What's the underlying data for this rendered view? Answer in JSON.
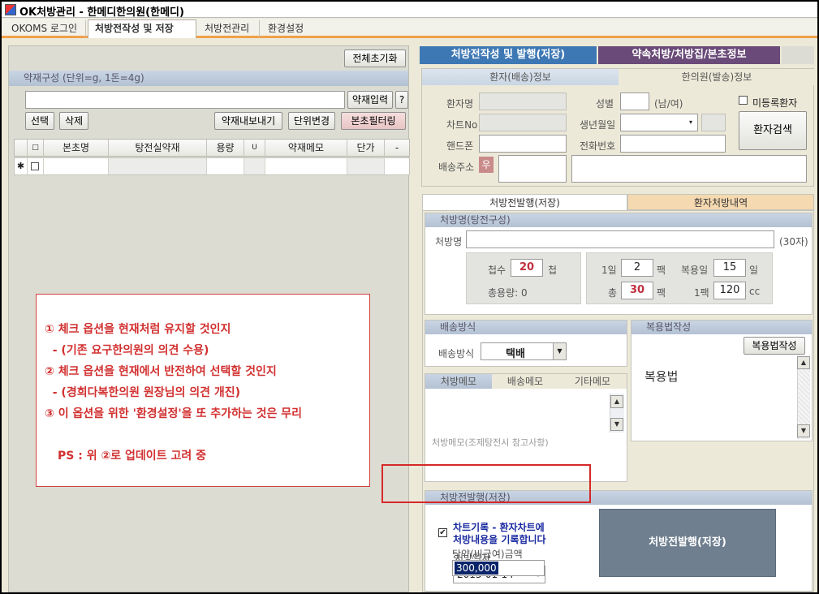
{
  "window": {
    "title": "OK처방관리 - 한메디한의원(한메디)"
  },
  "tabs": [
    {
      "label": "OKOMS 로그인"
    },
    {
      "label": "처방전작성 및 저장"
    },
    {
      "label": "처방전관리"
    },
    {
      "label": "환경설정"
    }
  ],
  "left": {
    "reset_label": "전체초기화",
    "herb_section_title": "약재구성 (단위=g, 1돈=4g)",
    "herb_input_button": "약재입력",
    "help_button": "?",
    "select_button": "선택",
    "delete_button": "삭제",
    "export_button": "약재내보내기",
    "unit_change_button": "단위변경",
    "filter_button": "본초필터링",
    "grid_headers": [
      "□",
      "본초명",
      "탕전실약재",
      "용량",
      "U",
      "약재메모",
      "단가",
      "-"
    ],
    "new_row_marker": "✱"
  },
  "memo": {
    "lines": [
      "① 체크 옵션을 현재처럼 유지할 것인지",
      "  - (기존 요구한의원의 의견 수용)",
      "② 체크 옵션을 현재에서 반전하여 선택할 것인지",
      "  - (경희다복한의원 원장님의 의견 개진)",
      "③ 이 옵션을 위한 '환경설정'을 또 추가하는 것은 무리",
      "PS : 위 ②로 업데이트 고려 중"
    ]
  },
  "right": {
    "main_tab1": "처방전작성 및 발행(저장)",
    "main_tab2": "약속처방/처방집/본초정보",
    "patient_tab": "환자(배송)정보",
    "clinic_tab": "한의원(발송)정보",
    "patient_name_label": "환자명",
    "gender_label": "성별",
    "gender_hint": "(남/여)",
    "unregistered_label": "미등록환자",
    "chart_label": "차트No",
    "birth_label": "생년월일",
    "phone_label": "핸드폰",
    "tel_label": "전화번호",
    "search_button": "환자검색",
    "address_label": "배송주소",
    "zip_button": "우",
    "issue_tab": "처방전발행(저장)",
    "history_tab": "환자처방내역",
    "rx_section": "처방명(탕전구성)",
    "rx_name_label": "처방명",
    "rx_limit": "(30자)",
    "cheop_label": "첩수",
    "cheop_value": "20",
    "cheop_unit": "첩",
    "total_volume_label": "총용량: 0",
    "daily_label": "1일",
    "daily_value": "2",
    "pack_unit": "팩",
    "days_label": "복용일",
    "days_value": "15",
    "day_unit": "일",
    "total_label": "총",
    "total_value": "30",
    "pack_label": "1팩",
    "pack_value": "120",
    "cc_unit": "cc",
    "delivery_section": "배송방식",
    "delivery_label": "배송방식",
    "delivery_value": "택배",
    "dosage_section": "복용법작성",
    "dosage_button": "복용법작성",
    "dosage_text": "복용법",
    "memo_tabs": [
      "처방메모",
      "배송메모",
      "기타메모"
    ],
    "memo_placeholder": "처방메모(조제탕전시 참고사항)",
    "issue_section": "처방전발행(저장)",
    "chart_record_line1": "차트기록 - 환자차트에",
    "chart_record_line2": "처방내용을 기록합니다",
    "rx_date_label": "처방일자",
    "rx_date_value": "2013-01-14",
    "price_label": "탕약(비급여)금액",
    "price_value": "300,000",
    "issue_button": "처방전발행(저장)"
  }
}
